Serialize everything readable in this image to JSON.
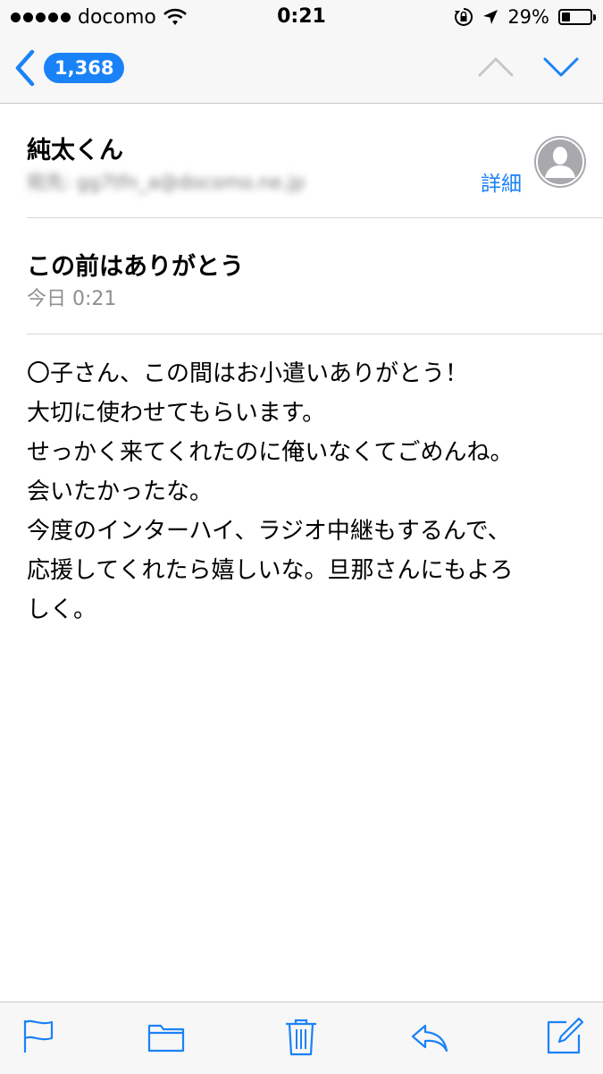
{
  "status_bar": {
    "carrier": "docomo",
    "time": "0:21",
    "battery": "29%",
    "battery_level": 0.29
  },
  "nav": {
    "badge_count": "1,368"
  },
  "email": {
    "sender": "純太くん",
    "recipient": "宛先: gg7tfn_a@docomo.ne.jp",
    "details_label": "詳細",
    "subject": "この前はありがとう",
    "date": "今日 0:21",
    "body_lines": [
      "〇子さん、この間はお小遣いありがとう！",
      "大切に使わせてもらいます。",
      "せっかく来てくれたのに俺いなくてごめんね。",
      "会いたかったな。",
      "今度のインターハイ、ラジオ中継もするんで、",
      "応援してくれたら嬉しいな。旦那さんにもよろ",
      "しく。"
    ]
  },
  "icons": {
    "signal": "signal-dots-icon",
    "wifi": "wifi-icon",
    "orientation_lock": "orientation-lock-icon",
    "location": "location-arrow-icon",
    "back": "chevron-left-icon",
    "previous": "chevron-up-icon",
    "next": "chevron-down-icon",
    "avatar": "person-silhouette-icon",
    "flag": "flag-icon",
    "folder": "folder-icon",
    "trash": "trash-icon",
    "reply": "reply-icon",
    "compose": "compose-icon"
  },
  "colors": {
    "accent": "#1a82f7",
    "disabled": "#c7c7cc",
    "secondary_text": "#8e8e93"
  }
}
